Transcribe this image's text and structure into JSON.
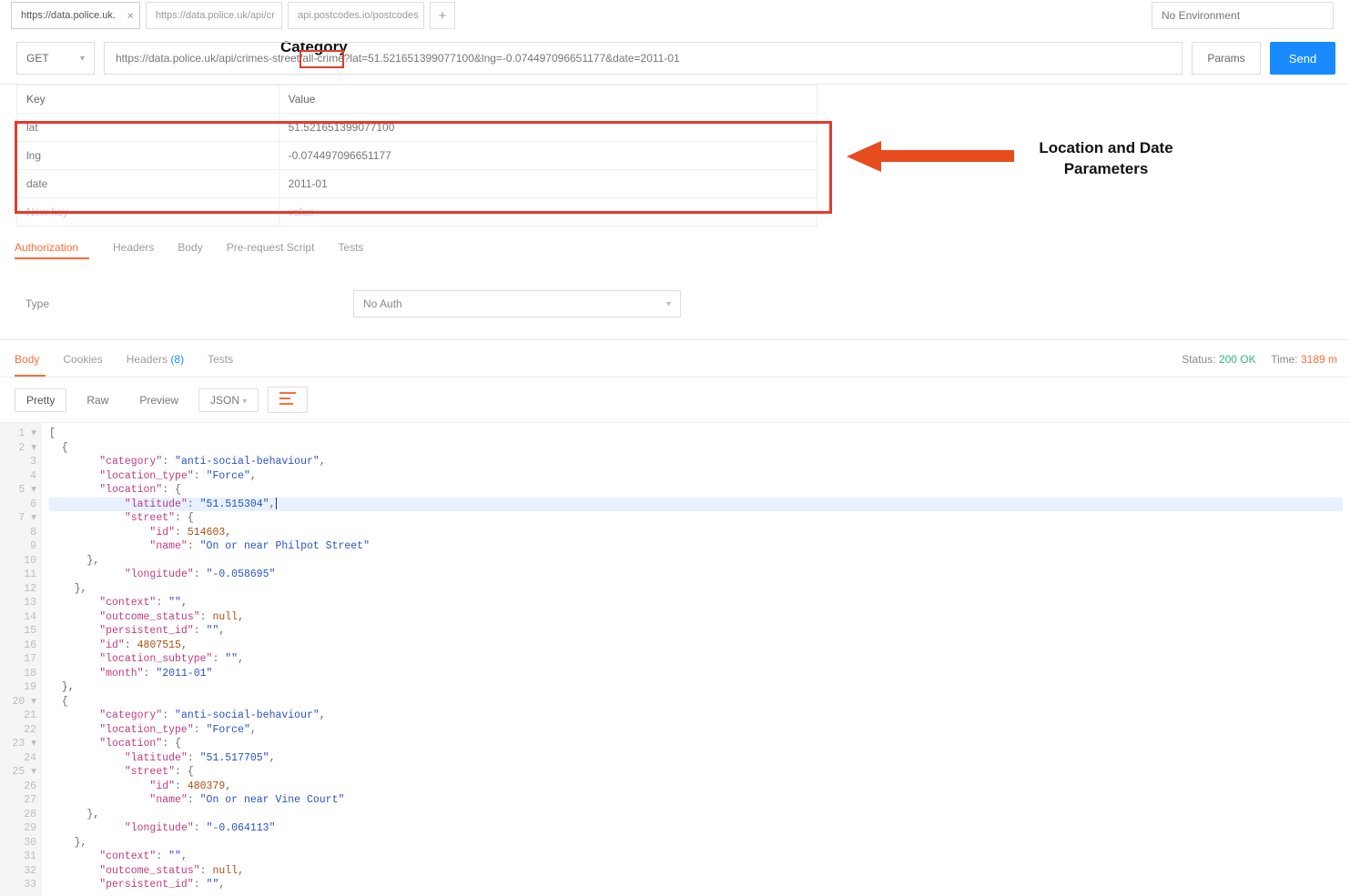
{
  "env": {
    "label": "No Environment"
  },
  "tabs": [
    {
      "label": "https://data.police.uk.",
      "closeable": true
    },
    {
      "label": "https://data.police.uk/api/cr",
      "closeable": false
    },
    {
      "label": "api.postcodes.io/postcodes",
      "closeable": false
    }
  ],
  "request": {
    "method": "GET",
    "url": "https://data.police.uk/api/crimes-street/all-crime?lat=51.521651399077100&lng=-0.074497096651177&date=2011-01",
    "params_btn": "Params",
    "send_btn": "Send"
  },
  "params": {
    "headers": {
      "key": "Key",
      "value": "Value"
    },
    "rows": [
      {
        "key": "lat",
        "value": "51.521651399077100"
      },
      {
        "key": "lng",
        "value": "-0.074497096651177"
      },
      {
        "key": "date",
        "value": "2011-01"
      }
    ],
    "newrow": {
      "key": "New key",
      "value": "value"
    }
  },
  "annotations": {
    "category": "Category",
    "locdate_line1": "Location and Date",
    "locdate_line2": "Parameters"
  },
  "subtabs": {
    "authorization": "Authorization",
    "headers": "Headers",
    "body": "Body",
    "prerequest": "Pre-request Script",
    "tests": "Tests"
  },
  "auth": {
    "type_label": "Type",
    "selection": "No Auth"
  },
  "response": {
    "body": "Body",
    "cookies": "Cookies",
    "headers": "Headers",
    "headers_count": "(8)",
    "tests": "Tests",
    "status_label": "Status:",
    "status_value": "200 OK",
    "time_label": "Time:",
    "time_value": "3189 m"
  },
  "view": {
    "pretty": "Pretty",
    "raw": "Raw",
    "preview": "Preview",
    "format": "JSON"
  },
  "json_body": [
    {
      "n": 1,
      "f": "-",
      "t": "["
    },
    {
      "n": 2,
      "f": "-",
      "t": "  {"
    },
    {
      "n": 3,
      "f": "",
      "kv": {
        "k": "category",
        "sv": "anti-social-behaviour"
      },
      "i": 4,
      "c": true
    },
    {
      "n": 4,
      "f": "",
      "kv": {
        "k": "location_type",
        "sv": "Force"
      },
      "i": 4,
      "c": true
    },
    {
      "n": 5,
      "f": "-",
      "kb": {
        "k": "location"
      },
      "i": 4
    },
    {
      "n": 6,
      "f": "",
      "hl": true,
      "kv": {
        "k": "latitude",
        "sv": "51.515304"
      },
      "i": 6,
      "c": true,
      "cursor": true
    },
    {
      "n": 7,
      "f": "-",
      "kb": {
        "k": "street"
      },
      "i": 6
    },
    {
      "n": 8,
      "f": "",
      "kv": {
        "k": "id",
        "nv": "514603"
      },
      "i": 8,
      "c": true
    },
    {
      "n": 9,
      "f": "",
      "kv": {
        "k": "name",
        "sv": "On or near Philpot Street"
      },
      "i": 8
    },
    {
      "n": 10,
      "f": "",
      "t": "      },",
      "rc": true
    },
    {
      "n": 11,
      "f": "",
      "kv": {
        "k": "longitude",
        "sv": "-0.058695"
      },
      "i": 6
    },
    {
      "n": 12,
      "f": "",
      "t": "    },",
      "rc": true
    },
    {
      "n": 13,
      "f": "",
      "kv": {
        "k": "context",
        "sv": ""
      },
      "i": 4,
      "c": true
    },
    {
      "n": 14,
      "f": "",
      "kv": {
        "k": "outcome_status",
        "nullv": true
      },
      "i": 4,
      "c": true
    },
    {
      "n": 15,
      "f": "",
      "kv": {
        "k": "persistent_id",
        "sv": ""
      },
      "i": 4,
      "c": true
    },
    {
      "n": 16,
      "f": "",
      "kv": {
        "k": "id",
        "nv": "4807515"
      },
      "i": 4,
      "c": true
    },
    {
      "n": 17,
      "f": "",
      "kv": {
        "k": "location_subtype",
        "sv": ""
      },
      "i": 4,
      "c": true
    },
    {
      "n": 18,
      "f": "",
      "kv": {
        "k": "month",
        "sv": "2011-01"
      },
      "i": 4
    },
    {
      "n": 19,
      "f": "",
      "t": "  },",
      "rc": true
    },
    {
      "n": 20,
      "f": "-",
      "t": "  {"
    },
    {
      "n": 21,
      "f": "",
      "kv": {
        "k": "category",
        "sv": "anti-social-behaviour"
      },
      "i": 4,
      "c": true
    },
    {
      "n": 22,
      "f": "",
      "kv": {
        "k": "location_type",
        "sv": "Force"
      },
      "i": 4,
      "c": true
    },
    {
      "n": 23,
      "f": "-",
      "kb": {
        "k": "location"
      },
      "i": 4
    },
    {
      "n": 24,
      "f": "",
      "kv": {
        "k": "latitude",
        "sv": "51.517705"
      },
      "i": 6,
      "c": true
    },
    {
      "n": 25,
      "f": "-",
      "kb": {
        "k": "street"
      },
      "i": 6
    },
    {
      "n": 26,
      "f": "",
      "kv": {
        "k": "id",
        "nv": "480379"
      },
      "i": 8,
      "c": true
    },
    {
      "n": 27,
      "f": "",
      "kv": {
        "k": "name",
        "sv": "On or near Vine Court"
      },
      "i": 8
    },
    {
      "n": 28,
      "f": "",
      "t": "      },",
      "rc": true
    },
    {
      "n": 29,
      "f": "",
      "kv": {
        "k": "longitude",
        "sv": "-0.064113"
      },
      "i": 6
    },
    {
      "n": 30,
      "f": "",
      "t": "    },",
      "rc": true
    },
    {
      "n": 31,
      "f": "",
      "kv": {
        "k": "context",
        "sv": ""
      },
      "i": 4,
      "c": true
    },
    {
      "n": 32,
      "f": "",
      "kv": {
        "k": "outcome_status",
        "nullv": true
      },
      "i": 4,
      "c": true
    },
    {
      "n": 33,
      "f": "",
      "kv": {
        "k": "persistent_id",
        "sv": ""
      },
      "i": 4,
      "c": true
    }
  ]
}
